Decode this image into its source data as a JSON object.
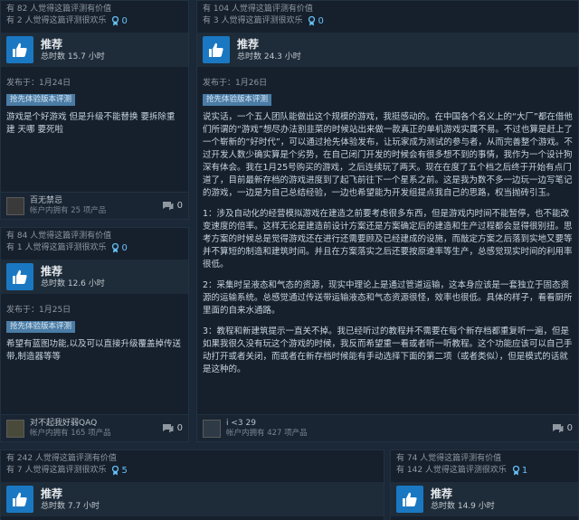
{
  "colors": {
    "background": "#1b2838",
    "card": "#16202d",
    "accent": "#66c0f4",
    "thumb": "#1a78c2",
    "tag": "#4a7ca5"
  },
  "reviews": [
    {
      "helpful": "有 82 人觉得这篇评测有价值",
      "funny": "有 2 人觉得这篇评测很欢乐",
      "awards": "0",
      "recommend": "推荐",
      "hours": "总时数 15.7 小时",
      "posted": "发布于：1月24日",
      "early_access": "抢先体验版本评测",
      "paragraphs": [
        "游戏是个好游戏 但是升级不能替换 要拆除重建 天哪 要死啦"
      ],
      "user_name": "百无禁忌",
      "user_owned": "帐户内拥有 25 项产品",
      "comments": "0"
    },
    {
      "helpful": "有 104 人觉得这篇评测有价值",
      "funny": "有 3 人觉得这篇评测很欢乐",
      "awards": "0",
      "recommend": "推荐",
      "hours": "总时数 24.3 小时",
      "posted": "发布于：1月26日",
      "early_access": "抢先体验版本评测",
      "paragraphs": [
        "说实话，一个五人团队能做出这个规模的游戏，我挺感动的。在中国各个名义上的“大厂”都在借他们所谓的“游戏”想尽办法割韭菜的时候站出来做一款真正的单机游戏实属不易。不过也算是赶上了一个崭新的“好时代”，可以通过抢先体验发布，让玩家成为测试的参与者，从而完善整个游戏。不过开发人数少确实算是个劣势，在自己闭门开发的时候会有很多想不到的事情，我作为一个设计狗深有体会。我在1月25号购买的游戏，之后连续玩了两天。现在在度了五个档之后终于开始有点门道了，目前最新存档的游戏进度到了起飞前往下一个星系之前。这是我为数不多一边玩一边写笔记的游戏，一边是为自己总结经验，一边也希望能为开发组提点我自己的思路，权当抛砖引玉。",
        "1：涉及自动化的经营模拟游戏在建造之前要考虑很多东西，但是游戏内时间不能暂停，也不能改变速度的倍率。这样无论是建造前设计方案还是方案确定后的建造和生产过程都会显得很别扭。思考方案的时候总是觉得游戏还在进行还需要顾及已经建成的设施，而敲定方案之后落到实地又要等并不算短的制造和建筑时间。并且在方案落实之后还要按原速率等生产，总感觉现实时间的利用率很低。",
        "2：采集时呈液态和气态的资源，现实中理论上是通过管道运输，这本身应该是一套独立于固态资源的运输系统。总感觉通过传送带运输液态和气态资源很怪，效率也很低。具体的样子，看看厨所里面的自来水通路。",
        "3：教程和新建筑提示一直关不掉。我已经听过的教程并不需要在每个新存档都重复听一遍，但是如果我很久没有玩这个游戏的时候，我反而希望重一看或者听一听教程。这个功能应该可以自己手动打开或者关闭，而或者在新存档时候能有手动选择下面的第二项（或者类似），但是模式的话就是这种的。"
      ],
      "user_name": "i <3 29",
      "user_owned": "帐户内拥有 427 项产品",
      "comments": "0"
    },
    {
      "helpful": "有 84 人觉得这篇评测有价值",
      "funny": "有 1 人觉得这篇评测很欢乐",
      "awards": "0",
      "recommend": "推荐",
      "hours": "总时数 12.6 小时",
      "posted": "发布于：1月25日",
      "early_access": "抢先体验版本评测",
      "paragraphs": [
        "希望有蓝图功能,以及可以直接升级覆盖掉传送带,制造器等等"
      ],
      "user_name": "对不起我好弱QAQ",
      "user_owned": "帐户内拥有 165 项产品",
      "comments": "0"
    },
    {
      "helpful": "有 242 人觉得这篇评测有价值",
      "funny": "有 7 人觉得这篇评测很欢乐",
      "awards": "5",
      "recommend": "推荐",
      "hours": "总时数 7.7 小时"
    },
    {
      "helpful": "有 74 人觉得这篇评测有价值",
      "funny": "有 142 人觉得这篇评测很欢乐",
      "awards": "1",
      "recommend": "推荐",
      "hours": "总时数 14.9 小时"
    }
  ]
}
